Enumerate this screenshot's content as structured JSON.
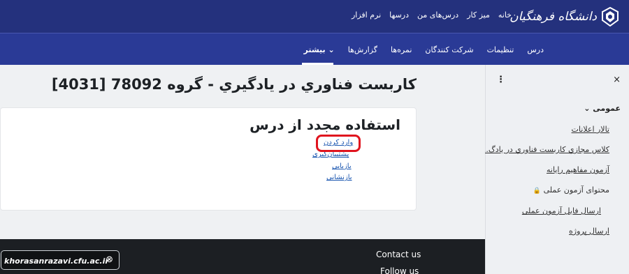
{
  "topbar": {
    "logo_text": "دانشگاه فرهنگیان",
    "nav": [
      "خانه",
      "میز کار",
      "درس‌های من",
      "درسها",
      "نرم افزار"
    ]
  },
  "secondary_nav": {
    "items": [
      "درس",
      "تنظیمات",
      "شرکت کنندگان",
      "نمره‌ها",
      "گزارش‌ها",
      "بیشتر"
    ],
    "more_chevron": "⌄"
  },
  "sidebar": {
    "close": "×",
    "kebab": "⋮",
    "section": "عمومی",
    "section_chevron": "⌄",
    "items": [
      "تالار اعلانات",
      "کلاس مجازي کاربست فناوري در يادگ...",
      "آزمون مفاهیم رایانه",
      "محتوای آزمون عملی",
      "ارسال فایل آزمون عملی",
      "ارسال پروژه"
    ],
    "lock_icon": "🔒"
  },
  "main": {
    "course_title": "كاربست فناوري در يادگيري - گروه 78092 [4031]",
    "card_title": "استفاده مجدد از درس",
    "links": [
      "وارد کردن",
      "پشتیبان‌گیری",
      "بازیابی",
      "بازنشانی"
    ]
  },
  "footer": {
    "contact": "Contact us",
    "follow": "Follow us"
  },
  "badge": {
    "text": "khorasanrazavi.cfu.ac.ir",
    "icon": "⊗"
  }
}
